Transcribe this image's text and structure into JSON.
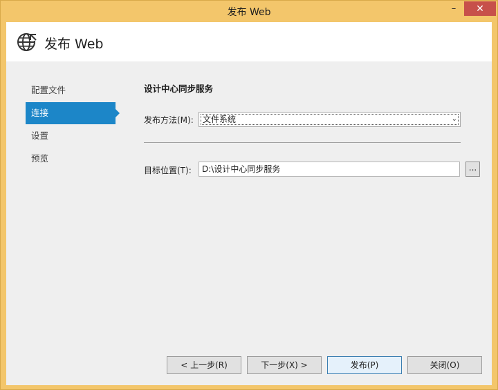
{
  "window": {
    "title": "发布 Web",
    "minimize_glyph": "–",
    "close_glyph": "✕"
  },
  "header": {
    "icon": "globe-icon",
    "title": "发布 Web"
  },
  "nav": {
    "items": [
      {
        "label": "配置文件",
        "active": false
      },
      {
        "label": "连接",
        "active": true
      },
      {
        "label": "设置",
        "active": false
      },
      {
        "label": "预览",
        "active": false
      }
    ]
  },
  "connection": {
    "section_title": "设计中心同步服务",
    "publish_method_label": "发布方法(M):",
    "publish_method_value": "文件系统",
    "target_location_label": "目标位置(T):",
    "target_location_value": "D:\\设计中心同步服务",
    "browse_label": "..."
  },
  "buttons": {
    "prev": "< 上一步(R)",
    "next": "下一步(X) >",
    "publish": "发布(P)",
    "close": "关闭(O)"
  },
  "colors": {
    "frame": "#f3c66b",
    "accent": "#1c86c8",
    "close_button": "#c7504a"
  }
}
